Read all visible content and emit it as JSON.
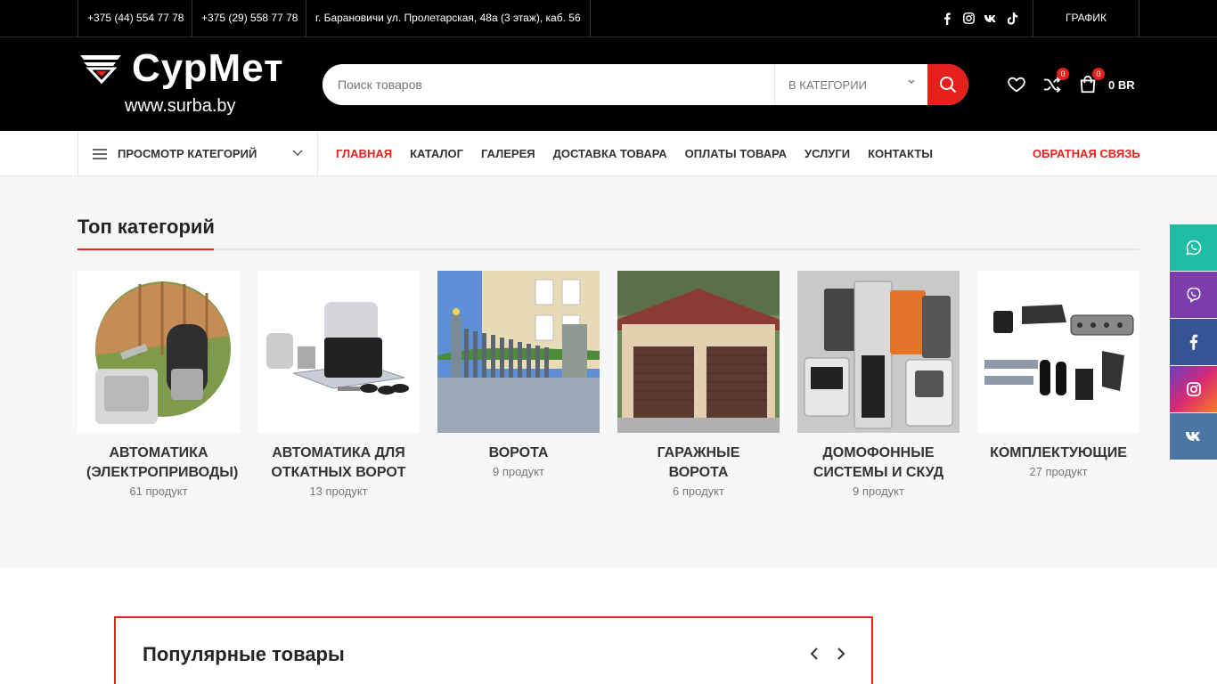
{
  "topbar": {
    "phone1": "+375 (44) 554 77 78",
    "phone2": "+375 (29) 558 77 78",
    "address": "г. Барановичи ул. Пролетарская, 48а (3 этаж), каб. 56",
    "social_icons": [
      "facebook-icon",
      "instagram-icon",
      "vk-icon",
      "tiktok-icon"
    ],
    "schedule": "ГРАФИК РАБОТЫ"
  },
  "header": {
    "logo_text": "СурМет",
    "logo_url": "www.surba.by",
    "search_placeholder": "Поиск товаров",
    "category_select": "В КАТЕГОРИИ",
    "compare_count": "0",
    "cart_count": "0",
    "cart_total": "0 BR"
  },
  "nav": {
    "categories_button": "ПРОСМОТР КАТЕГОРИЙ",
    "items": [
      "ГЛАВНАЯ",
      "КАТАЛОГ",
      "ГАЛЕРЕЯ",
      "ДОСТАВКА ТОВАРА",
      "ОПЛАТЫ ТОВАРА",
      "УСЛУГИ",
      "КОНТАКТЫ"
    ],
    "feedback": "ОБРАТНАЯ СВЯЗЬ"
  },
  "top_categories": {
    "title": "Топ категорий",
    "items": [
      {
        "name": "АВТОМАТИКА (ЭЛЕКТРОПРИВОДЫ)",
        "count": "61 продукт"
      },
      {
        "name": "АВТОМАТИКА ДЛЯ ОТКАТНЫХ ВОРОТ",
        "count": "13 продукт"
      },
      {
        "name": "ВОРОТА",
        "count": "9 продукт"
      },
      {
        "name": "ГАРАЖНЫЕ ВОРОТА",
        "count": "6 продукт"
      },
      {
        "name": "ДОМОФОННЫЕ СИСТЕМЫ И СКУД",
        "count": "9 продукт"
      },
      {
        "name": "КОМПЛЕКТУЮЩИЕ",
        "count": "27 продукт"
      }
    ]
  },
  "side_social": [
    "whatsapp-icon",
    "viber-icon",
    "facebook-icon",
    "instagram-icon",
    "vk-icon"
  ],
  "colors": {
    "accent": "#e6211c",
    "whatsapp": "#1ebea5",
    "viber": "#7d3daf",
    "facebook": "#365493",
    "vk": "#4c75a3"
  },
  "popular": {
    "title": "Популярные товары"
  }
}
